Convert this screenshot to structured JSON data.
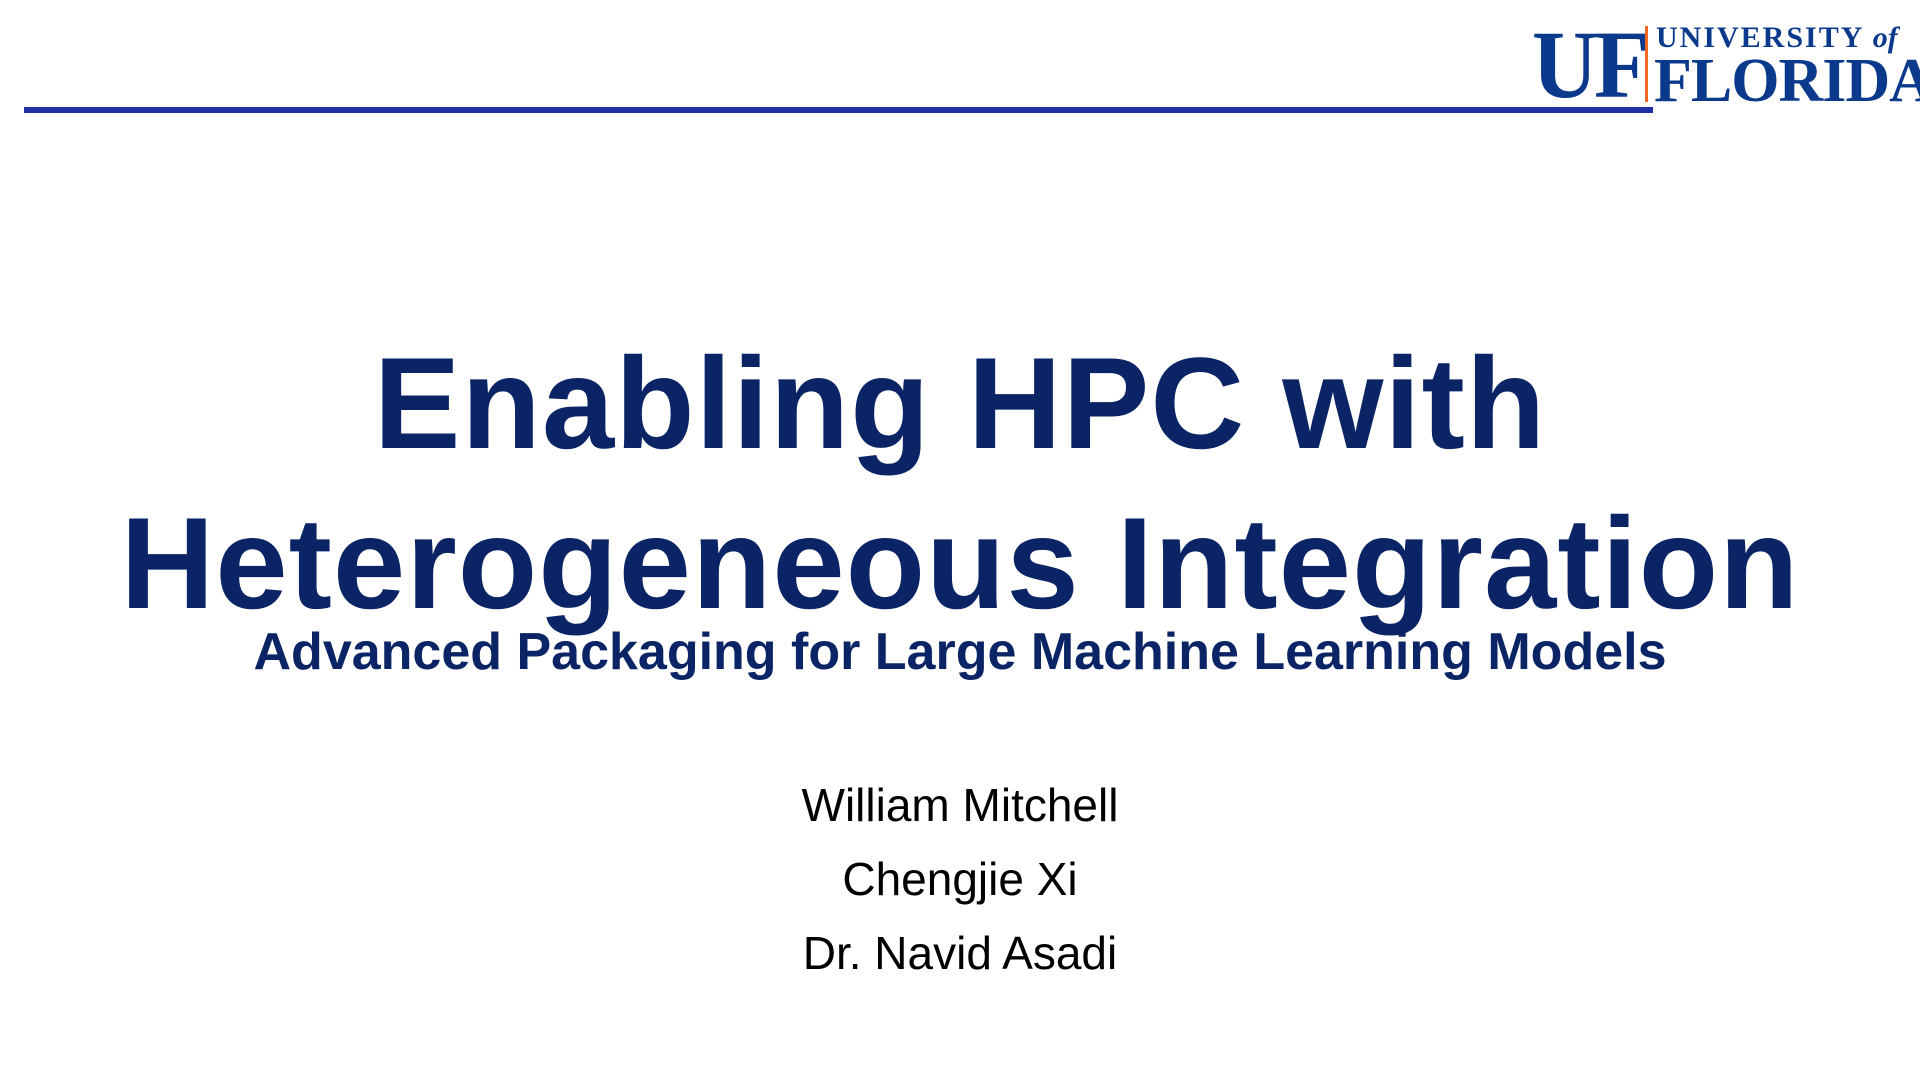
{
  "logo": {
    "mark": "UF",
    "university": "UNIVERSITY",
    "of": "of",
    "name": "FLORIDA"
  },
  "title": {
    "line1": "Enabling HPC with",
    "line2": "Heterogeneous Integration"
  },
  "subtitle": "Advanced Packaging for Large Machine Learning Models",
  "authors": [
    "William Mitchell",
    "Chengjie Xi",
    "Dr. Navid Asadi"
  ],
  "colors": {
    "title": "#0a2466",
    "rule": "#1f2fa8",
    "logo": "#0b3a8c",
    "logo_accent": "#f26a21"
  }
}
